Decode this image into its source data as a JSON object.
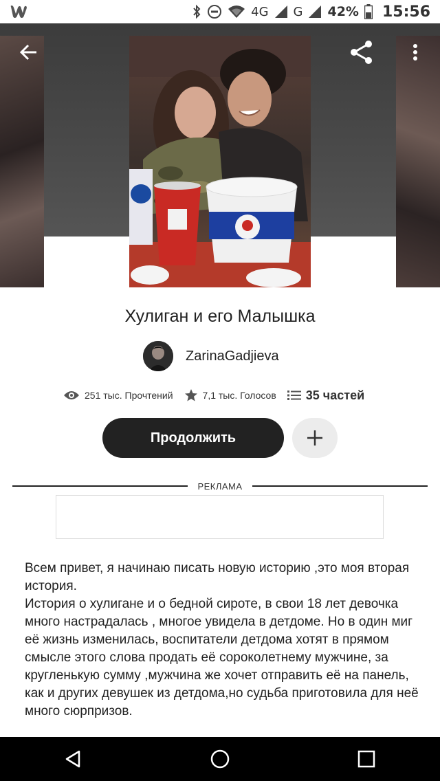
{
  "status_bar": {
    "app_logo": "W",
    "network_4g": "4G",
    "network_g": "G",
    "battery": "42%",
    "time": "15:56"
  },
  "header": {
    "back_icon": "arrow-left-icon",
    "share_icon": "share-icon",
    "more_icon": "more-vertical-icon"
  },
  "story": {
    "title": "Хулиган и его Малышка",
    "author": "ZarinaGadjieva",
    "reads": "251 тыс. Прочтений",
    "votes": "7,1 тыс. Голосов",
    "parts": "35 частей",
    "continue_label": "Продолжить",
    "description": "Всем привет, я начинаю писать новую историю ,это моя вторая история.\nИстория о хулигане и о бедной сироте, в свои 18 лет девочка много настрадалась , многое увидела в детдоме. Но в один миг её жизнь изменилась, воспитатели детдома хотят в прямом смысле этого слова продать её сороколетнему мужчине, за кругленькую сумму ,мужчина же хочет отправить её на панель, как и других девушек из детдома,но судьба приготовила для неё много сюрпризов."
  },
  "ad": {
    "label": "РЕКЛАМА"
  },
  "nav": {
    "back": "triangle-back-icon",
    "home": "circle-home-icon",
    "recents": "square-recents-icon"
  }
}
